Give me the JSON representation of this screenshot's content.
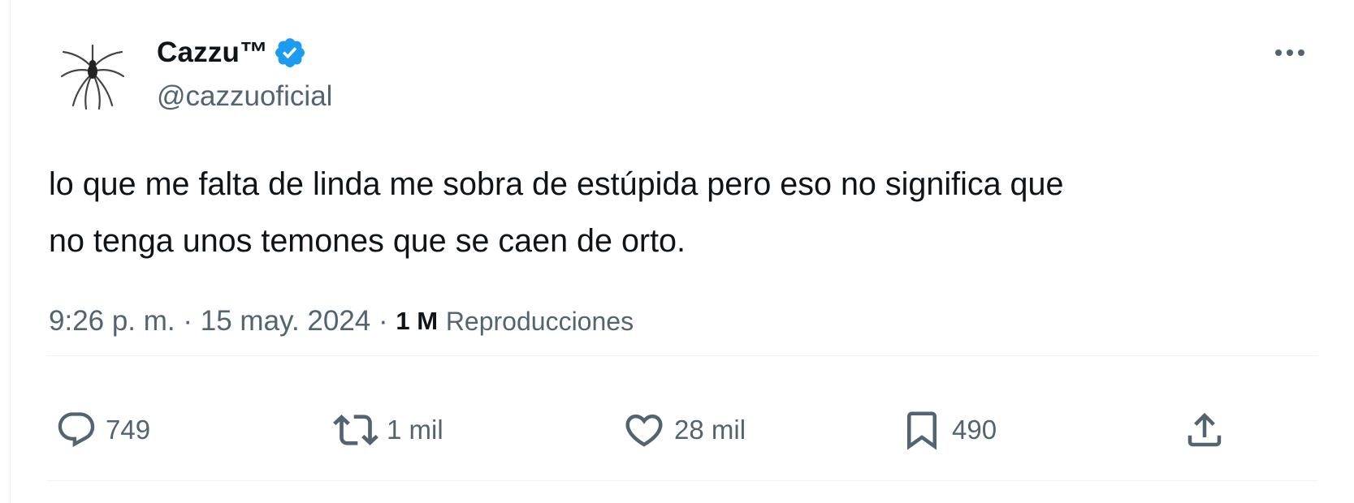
{
  "author": {
    "display_name": "Cazzu™",
    "handle": "@cazzuoficial",
    "verified": true,
    "avatar": "spider-logo"
  },
  "tweet": {
    "text": "lo que me falta de linda me sobra de estúpida pero eso no significa que\nno tenga unos temones que se caen de orto."
  },
  "meta": {
    "time": "9:26 p. m.",
    "separator": "·",
    "date": "15 may. 2024",
    "views_count": "1 M",
    "views_label": "Reproducciones"
  },
  "actions": {
    "replies": "749",
    "retweets": "1 mil",
    "likes": "28 mil",
    "bookmarks": "490"
  },
  "icons": {
    "more": "more-horizontal-icon",
    "reply": "reply-icon",
    "retweet": "retweet-icon",
    "like": "heart-icon",
    "bookmark": "bookmark-icon",
    "share": "share-icon",
    "verified": "verified-badge-icon"
  },
  "colors": {
    "text_primary": "#0f1419",
    "text_secondary": "#536471",
    "verified_blue": "#1d9bf0",
    "divider": "#eff3f4"
  }
}
